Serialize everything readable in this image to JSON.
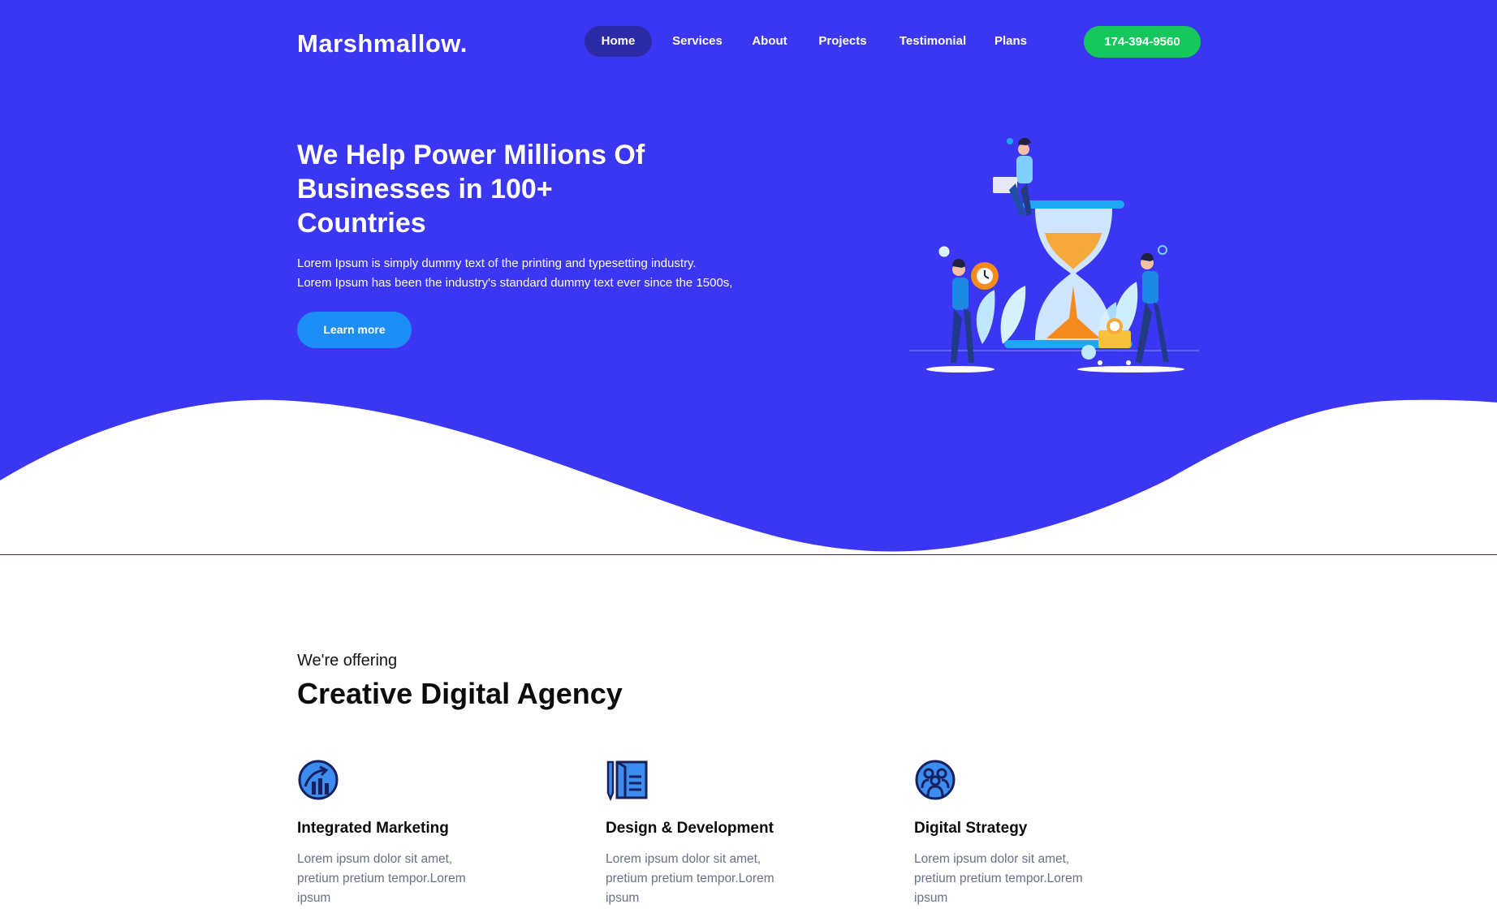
{
  "brand": "Marshmallow.",
  "nav": {
    "items": [
      {
        "label": "Home",
        "active": true
      },
      {
        "label": "Services",
        "active": false
      },
      {
        "label": "About",
        "active": false
      },
      {
        "label": "Projects",
        "active": false
      },
      {
        "label": "Testimonial",
        "active": false
      },
      {
        "label": "Plans",
        "active": false
      }
    ],
    "phone": "174-394-9560"
  },
  "hero": {
    "title": "We Help Power Millions Of Businesses in 100+ Countries",
    "description_line1": "Lorem Ipsum is simply dummy text of the printing and typesetting industry.",
    "description_line2": "Lorem Ipsum has been the industry's standard dummy text ever since the 1500s,",
    "cta": "Learn more",
    "illustration": "hourglass-team-illustration"
  },
  "offering": {
    "subtitle": "We're offering",
    "title": "Creative Digital Agency",
    "cards": [
      {
        "icon": "marketing-chart-icon",
        "title": "Integrated Marketing",
        "text": "Lorem ipsum dolor sit amet, pretium pretium tempor.Lorem ipsum"
      },
      {
        "icon": "design-document-icon",
        "title": "Design & Development",
        "text": "Lorem ipsum dolor sit amet, pretium pretium tempor.Lorem ipsum"
      },
      {
        "icon": "team-strategy-icon",
        "title": "Digital Strategy",
        "text": "Lorem ipsum dolor sit amet, pretium pretium tempor.Lorem ipsum"
      }
    ]
  },
  "colors": {
    "hero_bg": "#3a36f2",
    "nav_active": "#2d2aa8",
    "phone_btn": "#16c75b",
    "cta_btn": "#1d8ef5",
    "card_text": "#6b6f86"
  }
}
